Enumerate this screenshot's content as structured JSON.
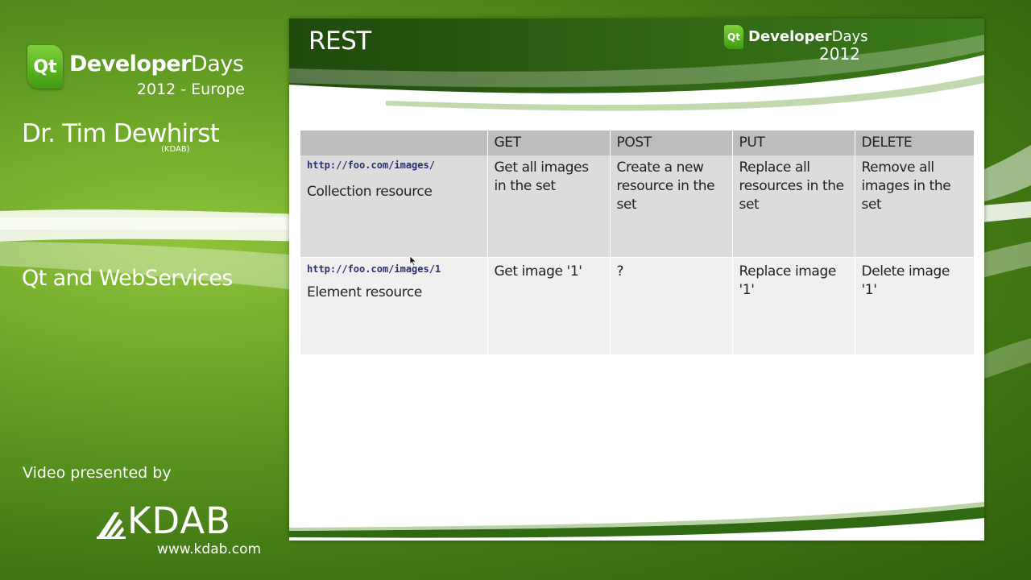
{
  "branding": {
    "qt_badge": "Qt",
    "dd_word_bold": "Developer",
    "dd_word_light": "Days",
    "edition": "2012 - Europe",
    "presenter": "Dr. Tim Dewhirst",
    "presenter_org": "(KDAB)",
    "talk_title": "Qt and WebServices",
    "presented_by": "Video presented by",
    "kdab_name": "KDAB",
    "kdab_url": "www.kdab.com"
  },
  "slide": {
    "title": "REST",
    "logo": {
      "badge": "Qt",
      "word_bold": "Developer",
      "word_light": "Days",
      "year": "2012"
    },
    "table": {
      "headers": [
        "",
        "GET",
        "POST",
        "PUT",
        "DELETE"
      ],
      "rows": [
        {
          "url": "http://foo.com/images/",
          "label": "Collection resource",
          "cells": [
            "Get all images in the set",
            "Create a new resource in the set",
            "Replace all resources in the set",
            "Remove all images in the set"
          ]
        },
        {
          "url": "http://foo.com/images/1",
          "label": "Element resource",
          "cells": [
            "Get image '1'",
            "?",
            "Replace image '1'",
            "Delete image '1'"
          ]
        }
      ]
    }
  },
  "icons": [
    "qt-logo-icon",
    "kdab-logo-icon",
    "mouse-cursor-icon"
  ],
  "colors": {
    "accent_green": "#3f7613",
    "header_gray": "#bdbdbd",
    "row1_gray": "#dcdcdc",
    "row2_gray": "#f0f0f0",
    "url_blue": "#2a2f6e"
  }
}
